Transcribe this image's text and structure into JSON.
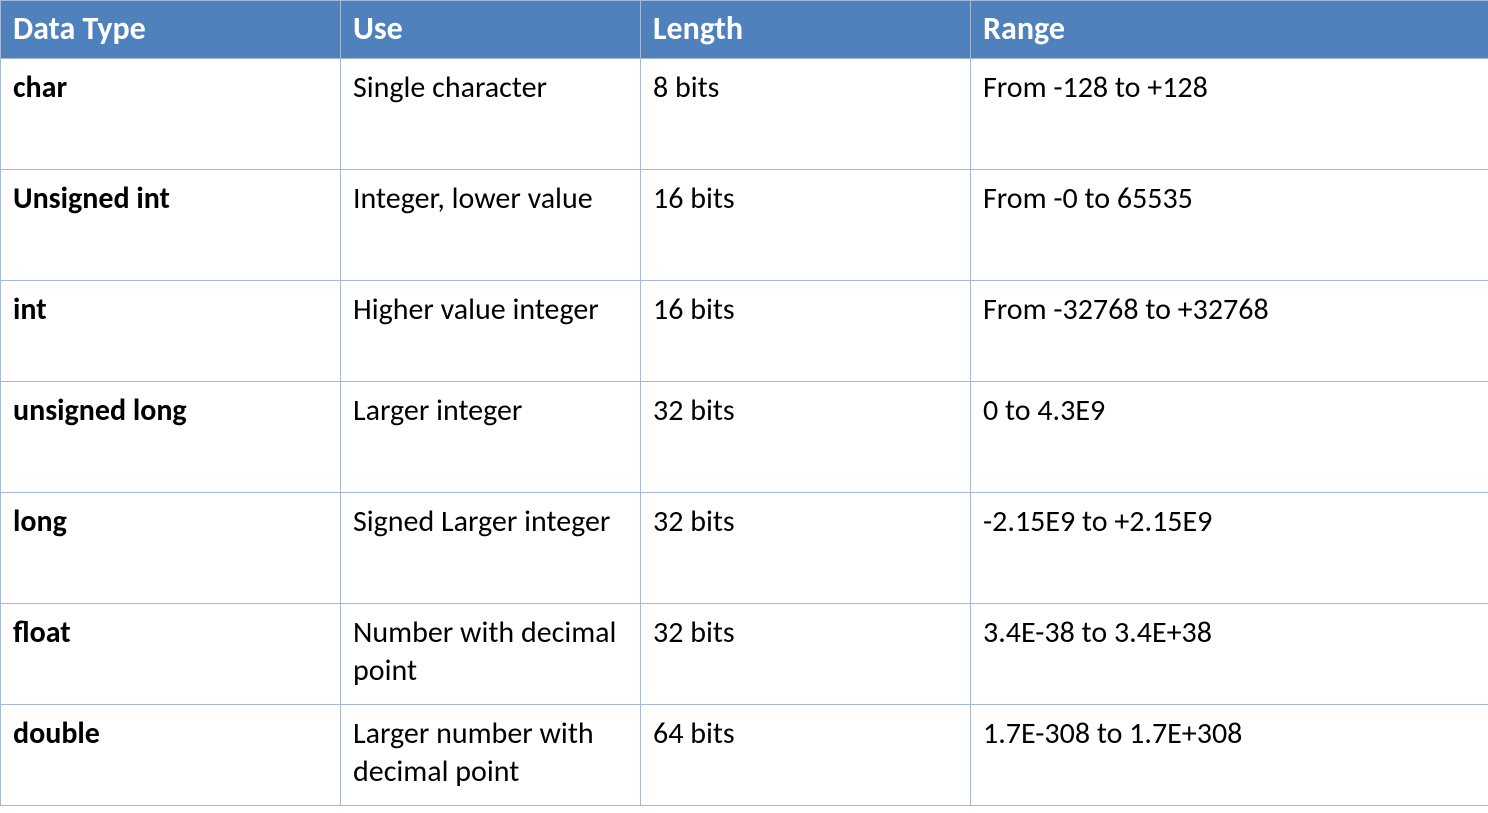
{
  "table": {
    "headers": {
      "data_type": "Data Type",
      "use": "Use",
      "length": "Length",
      "range": "Range"
    },
    "rows": [
      {
        "data_type": "char",
        "use": "Single character",
        "length": "8 bits",
        "range": " From -128 to +128"
      },
      {
        "data_type": "Unsigned  int",
        "use": "Integer, lower value",
        "length": "16 bits",
        "range": "From -0 to 65535"
      },
      {
        "data_type": "int",
        "use": "Higher value integer",
        "length": "16 bits",
        "range": "From -32768 to +32768"
      },
      {
        "data_type": "unsigned long",
        "use": "Larger integer",
        "length": "32 bits",
        "range": "0 to 4.3E9"
      },
      {
        "data_type": "long",
        "use": "Signed Larger integer",
        "length": "32 bits",
        "range": "-2.15E9 to +2.15E9"
      },
      {
        "data_type": "float",
        "use": "Number with decimal point",
        "length": "32 bits",
        "range": "3.4E-38 to 3.4E+38"
      },
      {
        "data_type": "double",
        "use": "Larger number with decimal point",
        "length": "64 bits",
        "range": "1.7E-308 to 1.7E+308"
      }
    ]
  }
}
